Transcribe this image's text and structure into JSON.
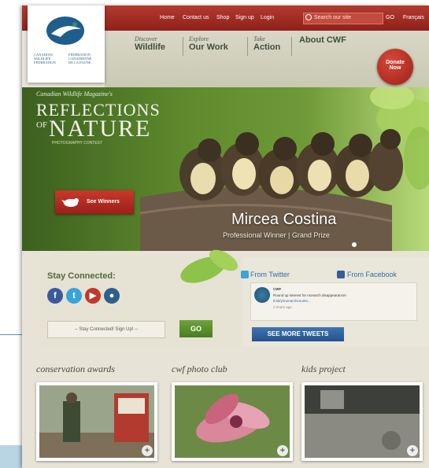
{
  "topbar": {
    "links": [
      "Home",
      "Contact us",
      "Shop",
      "Sign up",
      "Login"
    ],
    "search_placeholder": "Search our site",
    "go_label": "GO",
    "language": "Français"
  },
  "logo": {
    "line1_en": "CANADIAN",
    "line1_fr": "FÉDÉRATION",
    "line2_en": "WILDLIFE",
    "line2_fr": "CANADIENNE",
    "line3_en": "FEDERATION",
    "line3_fr": "DE LA FAUNE"
  },
  "nav": {
    "items": [
      {
        "small": "Discover",
        "big": "Wildlife"
      },
      {
        "small": "Explore",
        "big": "Our Work"
      },
      {
        "small": "Take",
        "big": "Action"
      },
      {
        "small": "",
        "big": "About CWF"
      }
    ],
    "donate_line1": "Donate",
    "donate_line2": "Now"
  },
  "hero": {
    "magazine": "Canadian Wildlife Magazine's",
    "title_line1": "REFLECTIONS",
    "title_of": "OF",
    "title_line2": "NATURE",
    "subtitle": "PHOTOGRAPHY CONTEST",
    "button": "See Winners",
    "winner_name": "Mircea Costina",
    "winner_title": "Professional Winner | Grand Prize"
  },
  "stay": {
    "title": "Stay Connected:",
    "social_icons": [
      "facebook-icon",
      "twitter-icon",
      "youtube-icon",
      "flickr-icon"
    ],
    "signup_placeholder": "-- Stay Connected! Sign Up! --",
    "go": "GO"
  },
  "feeds": {
    "twitter_title": "From Twitter",
    "facebook_title": "From Facebook",
    "tweet_author": "CWF",
    "tweet_line1": "Round up interest for monarch disappearance!",
    "tweet_line2": "tl.bit/y/monarchcounts...",
    "tweet_meta": "2 hours ago",
    "see_more": "SEE MORE TWEETS"
  },
  "sections": [
    {
      "title": "conservation awards"
    },
    {
      "title": "cwf photo club"
    },
    {
      "title": "kids project"
    }
  ],
  "colors": {
    "brand_red": "#a32b22",
    "accent_green": "#5a8f2b",
    "twitter_blue": "#2e6ea7"
  }
}
